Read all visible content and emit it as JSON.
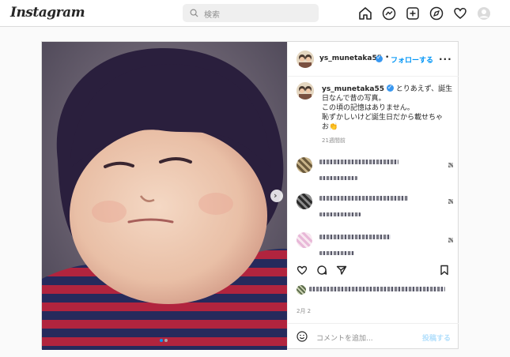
{
  "nav": {
    "logo": "Instagram",
    "search_placeholder": "検索",
    "icons": [
      "home-icon",
      "messenger-icon",
      "new-post-icon",
      "explore-icon",
      "activity-heart-icon",
      "profile-avatar"
    ]
  },
  "post": {
    "username": "ys_munetaka55",
    "follow_label": "フォローする",
    "separator": "•",
    "more_label": "...",
    "caption_lines": [
      "とりあえず、誕生",
      "日なんで昔の写真。",
      "この頃の記憶はありません。",
      "恥ずかしいけど誕生日だから載せちゃ",
      "お👏"
    ],
    "caption_time": "21週間前",
    "date": "2月 2",
    "carousel_next": "›",
    "carousel_count": 2,
    "carousel_active": 0,
    "comment_placeholder": "コメントを追加...",
    "post_button": "投稿する"
  },
  "colors": {
    "link_blue": "#0095f6",
    "verified_blue": "#3897f0",
    "post_disabled": "#b2dffc",
    "shirt_red": "#b1243e",
    "shirt_navy": "#262a5c"
  }
}
